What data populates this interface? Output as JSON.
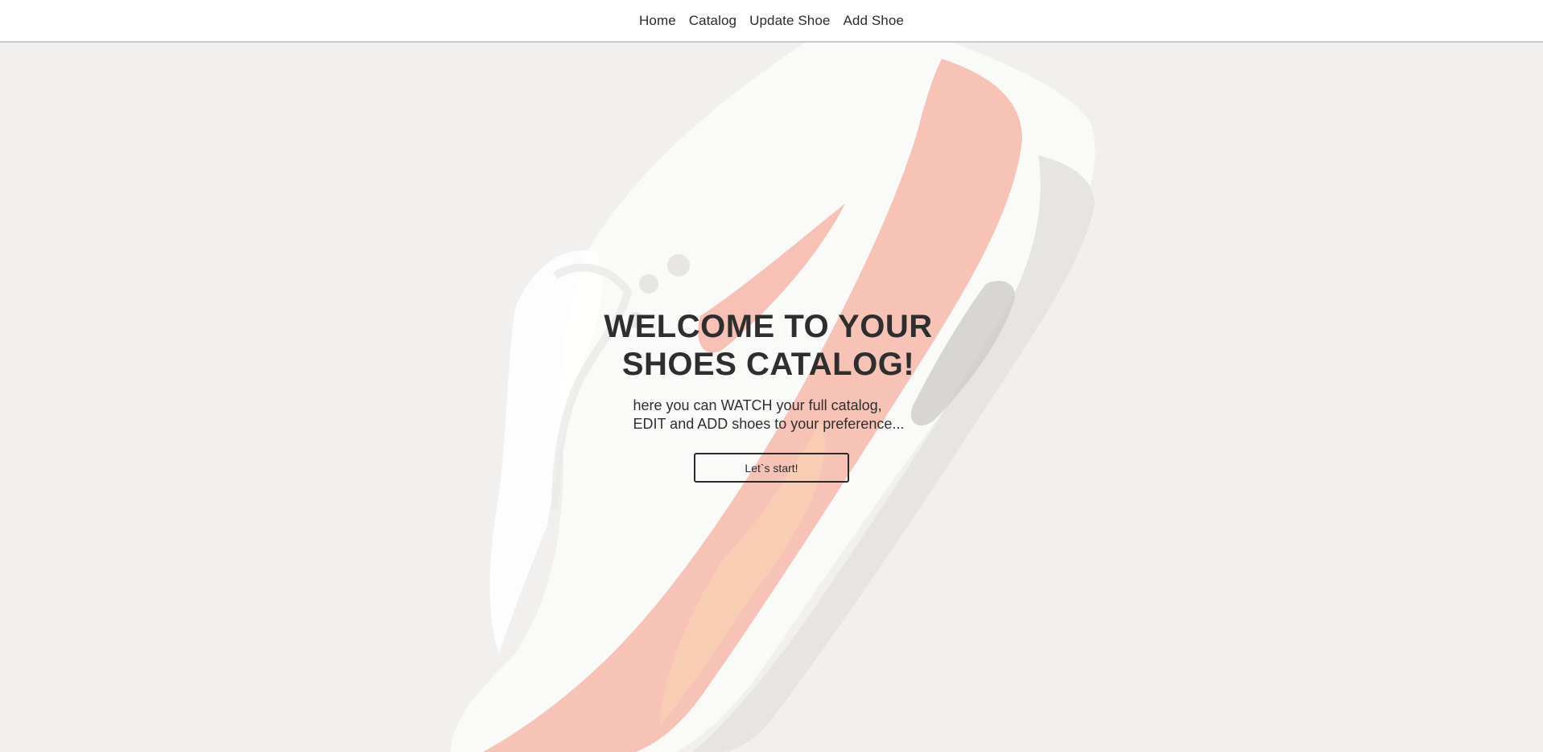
{
  "nav": {
    "items": [
      {
        "label": "Home"
      },
      {
        "label": "Catalog"
      },
      {
        "label": "Update Shoe"
      },
      {
        "label": "Add Shoe"
      }
    ]
  },
  "hero": {
    "title": "WELCOME TO YOUR SHOES CATALOG!",
    "subtitle_line1": "here you can WATCH your full catalog,",
    "subtitle_line2": "EDIT and ADD shoes to your preference...",
    "cta_label": "Let`s start!"
  },
  "colors": {
    "background": "#f1f0ef",
    "navbar": "#ffffff",
    "text": "#2e2e2e",
    "shoe_accent": "#f4a9a0"
  },
  "icons": {
    "background_image": "sneaker-image"
  }
}
